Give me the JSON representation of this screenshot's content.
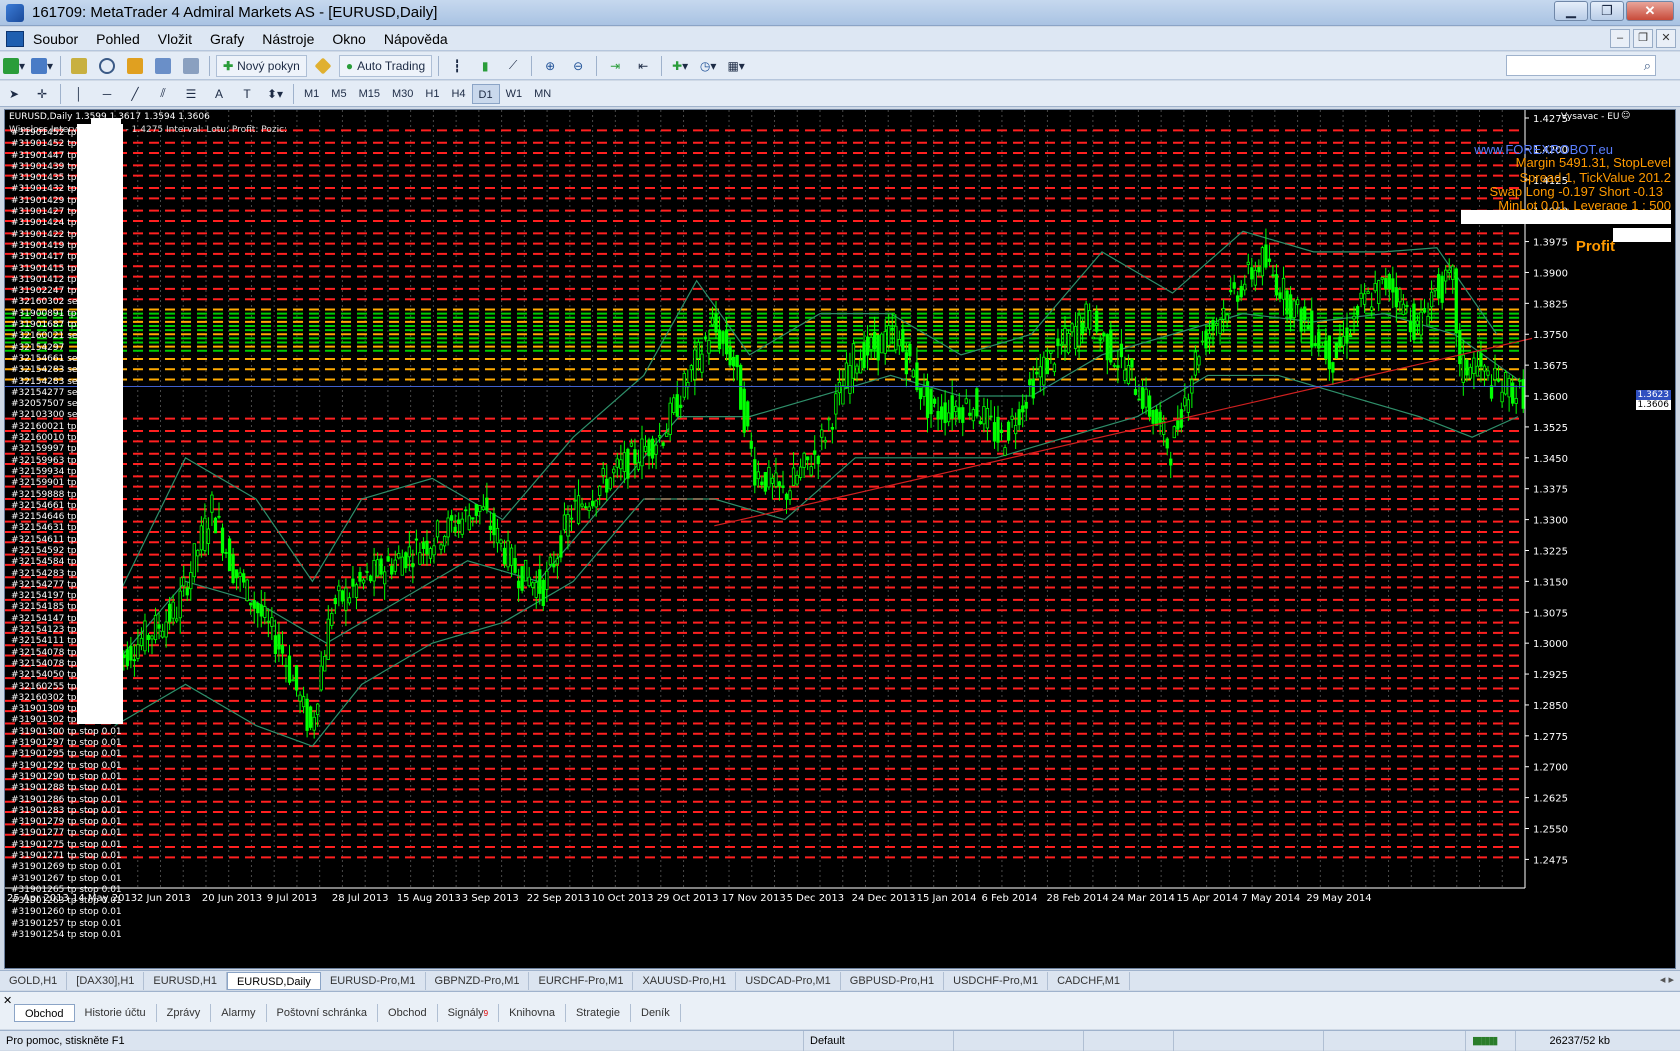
{
  "window": {
    "title": "161709: MetaTrader 4 Admiral Markets AS - [EURUSD,Daily]",
    "minimize": "▁",
    "maximize": "❐",
    "close": "✕"
  },
  "menu": [
    "Soubor",
    "Pohled",
    "Vložit",
    "Grafy",
    "Nástroje",
    "Okno",
    "Nápověda"
  ],
  "mdi_buttons": [
    "–",
    "❐",
    "✕"
  ],
  "toolbar": {
    "new_order": "Nový pokyn",
    "auto_trading": "Auto Trading"
  },
  "timeframes": [
    "M1",
    "M5",
    "M15",
    "M30",
    "H1",
    "H4",
    "D1",
    "W1",
    "MN"
  ],
  "active_timeframe": "D1",
  "chart": {
    "header": "EURUSD,Daily  1.3599 1.3617 1.3594 1.3606",
    "subheader": "Winsloss  Interval: 1.2425 - 1.4275   Interval:    Lotu:    Profit:    Pozic:",
    "expert_label": "Vysavac - EU",
    "info_lines": [
      "www.FOREXROBOT.eu",
      "Margin 5491.31, StopLevel",
      "Spread 1, TickValue 201.2",
      "Swap Long -0.197 Short -0.13",
      "MinLot 0.01, Leverage 1 : 500"
    ],
    "profit_label": "Profit",
    "current_price": "1.3606",
    "ask_price": "1.3623",
    "colors": {
      "background": "#000000",
      "candle": "#00ff00",
      "red_level": "#ff2020",
      "green_level": "#00cc00",
      "orange_level": "#ffaa00",
      "bands": "#2e8f6a",
      "trendline": "#d02020",
      "price_line": "#4060d0",
      "info_text": "#ff9a00"
    }
  },
  "orders": [
    "#31901452 tp",
    "#31901452 tp",
    "#31901447 tp",
    "#31901439 tp",
    "#31901435 tp",
    "#31901432 tp",
    "#31901429 tp",
    "#31901427 tp",
    "#31901424 tp",
    "#31901422 tp",
    "#31901419 tp",
    "#31901417 tp",
    "#31901415 tp",
    "#31901412 tp",
    "#31902247 tp",
    "#32160302 sel",
    "#31900891 tp",
    "#31901687 tp",
    "#32160021 se",
    "#32154297",
    "#32154661 se",
    "#32154283 se",
    "#32154283 sel",
    "#32154277 sel",
    "#32057507 sel",
    "#32103300 sel",
    "#32160021 tp",
    "#32160010 tp",
    "#32159997 tp",
    "#32159963 tp",
    "#32159934 tp",
    "#32159901 tp",
    "#32159888 tp",
    "#32154661 tp",
    "#32154646 tp",
    "#32154631 tp",
    "#32154611 tp",
    "#32154592 tp",
    "#32154584 tp",
    "#32154283 tp",
    "#32154277 tp",
    "#32154197 tp",
    "#32154185 tp",
    "#32154147 tp",
    "#32154123 tp",
    "#32154111 tp",
    "#32154078 tp",
    "#32154078 tp stop 0.01",
    "#32154050 tp stop 0.01",
    "#32160255 tp stop 0.01",
    "#32160302 tp stop 0.01",
    "#31901309 tp stop 0.01",
    "#31901302 tp stop 0.01",
    "#31901300 tp stop 0.01",
    "#31901297 tp stop 0.01",
    "#31901295 tp stop 0.01",
    "#31901292 tp stop 0.01",
    "#31901290 tp stop 0.01",
    "#31901288 tp stop 0.01",
    "#31901286 tp stop 0.01",
    "#31901283 tp stop 0.01",
    "#31901279 tp stop 0.01",
    "#31901277 tp stop 0.01",
    "#31901275 tp stop 0.01",
    "#31901271 tp stop 0.01",
    "#31901269 tp stop 0.01",
    "#31901267 tp stop 0.01",
    "#31901265 tp stop 0.01",
    "#31901263 tp stop 0.01",
    "#31901260 tp stop 0.01",
    "#31901257 tp stop 0.01",
    "#31901254 tp stop 0.01"
  ],
  "chart_data": {
    "type": "candlestick",
    "symbol": "EURUSD",
    "timeframe": "Daily",
    "ylim": [
      1.2425,
      1.4275
    ],
    "yticks": [
      "1.4275",
      "1.4200",
      "1.4125",
      "1.4050",
      "1.3975",
      "1.3900",
      "1.3825",
      "1.3750",
      "1.3675",
      "1.3600",
      "1.3525",
      "1.3450",
      "1.3375",
      "1.3300",
      "1.3225",
      "1.3150",
      "1.3075",
      "1.3000",
      "1.2925",
      "1.2850",
      "1.2775",
      "1.2700",
      "1.2625",
      "1.2550",
      "1.2475"
    ],
    "xticks": [
      "25 Apr 2013",
      "14 May 2013",
      "2 Jun 2013",
      "20 Jun 2013",
      "9 Jul 2013",
      "28 Jul 2013",
      "15 Aug 2013",
      "3 Sep 2013",
      "22 Sep 2013",
      "10 Oct 2013",
      "29 Oct 2013",
      "17 Nov 2013",
      "5 Dec 2013",
      "24 Dec 2013",
      "15 Jan 2014",
      "6 Feb 2014",
      "28 Feb 2014",
      "24 Mar 2014",
      "15 Apr 2014",
      "7 May 2014",
      "29 May 2014"
    ],
    "last": {
      "open": 1.3599,
      "high": 1.3617,
      "low": 1.3594,
      "close": 1.3606
    },
    "path_points": [
      [
        0,
        1.295
      ],
      [
        18,
        1.308
      ],
      [
        28,
        1.333
      ],
      [
        34,
        1.318
      ],
      [
        48,
        1.298
      ],
      [
        56,
        1.279
      ],
      [
        62,
        1.309
      ],
      [
        76,
        1.318
      ],
      [
        90,
        1.325
      ],
      [
        104,
        1.333
      ],
      [
        114,
        1.318
      ],
      [
        122,
        1.313
      ],
      [
        130,
        1.332
      ],
      [
        146,
        1.344
      ],
      [
        156,
        1.351
      ],
      [
        170,
        1.377
      ],
      [
        176,
        1.368
      ],
      [
        182,
        1.342
      ],
      [
        190,
        1.336
      ],
      [
        200,
        1.347
      ],
      [
        210,
        1.369
      ],
      [
        222,
        1.375
      ],
      [
        232,
        1.356
      ],
      [
        244,
        1.358
      ],
      [
        252,
        1.349
      ],
      [
        262,
        1.365
      ],
      [
        276,
        1.379
      ],
      [
        290,
        1.363
      ],
      [
        300,
        1.347
      ],
      [
        308,
        1.372
      ],
      [
        318,
        1.385
      ],
      [
        326,
        1.393
      ],
      [
        336,
        1.38
      ],
      [
        346,
        1.369
      ],
      [
        354,
        1.382
      ],
      [
        362,
        1.388
      ],
      [
        370,
        1.376
      ],
      [
        374,
        1.385
      ],
      [
        380,
        1.388
      ],
      [
        382,
        1.366
      ],
      [
        386,
        1.368
      ],
      [
        391,
        1.363
      ],
      [
        396,
        1.362
      ],
      [
        399,
        1.3606
      ]
    ],
    "bands": {
      "upper": [
        [
          0,
          1.31
        ],
        [
          20,
          1.345
        ],
        [
          40,
          1.335
        ],
        [
          56,
          1.315
        ],
        [
          70,
          1.335
        ],
        [
          90,
          1.34
        ],
        [
          110,
          1.33
        ],
        [
          130,
          1.35
        ],
        [
          150,
          1.365
        ],
        [
          165,
          1.388
        ],
        [
          180,
          1.37
        ],
        [
          200,
          1.38
        ],
        [
          220,
          1.38
        ],
        [
          240,
          1.37
        ],
        [
          260,
          1.375
        ],
        [
          280,
          1.395
        ],
        [
          300,
          1.385
        ],
        [
          320,
          1.4
        ],
        [
          340,
          1.395
        ],
        [
          360,
          1.395
        ],
        [
          375,
          1.396
        ],
        [
          392,
          1.375
        ]
      ],
      "middle": [
        [
          0,
          1.295
        ],
        [
          20,
          1.315
        ],
        [
          40,
          1.31
        ],
        [
          60,
          1.3
        ],
        [
          80,
          1.31
        ],
        [
          100,
          1.32
        ],
        [
          120,
          1.315
        ],
        [
          140,
          1.335
        ],
        [
          160,
          1.355
        ],
        [
          180,
          1.355
        ],
        [
          200,
          1.36
        ],
        [
          220,
          1.365
        ],
        [
          240,
          1.36
        ],
        [
          260,
          1.36
        ],
        [
          280,
          1.37
        ],
        [
          300,
          1.375
        ],
        [
          320,
          1.38
        ],
        [
          340,
          1.378
        ],
        [
          360,
          1.38
        ],
        [
          380,
          1.375
        ],
        [
          398,
          1.364
        ]
      ],
      "lower": [
        [
          0,
          1.28
        ],
        [
          20,
          1.29
        ],
        [
          40,
          1.28
        ],
        [
          56,
          1.275
        ],
        [
          70,
          1.29
        ],
        [
          90,
          1.3
        ],
        [
          110,
          1.305
        ],
        [
          130,
          1.315
        ],
        [
          150,
          1.335
        ],
        [
          170,
          1.335
        ],
        [
          190,
          1.33
        ],
        [
          210,
          1.345
        ],
        [
          230,
          1.345
        ],
        [
          250,
          1.345
        ],
        [
          270,
          1.35
        ],
        [
          290,
          1.355
        ],
        [
          310,
          1.365
        ],
        [
          330,
          1.365
        ],
        [
          350,
          1.36
        ],
        [
          370,
          1.355
        ],
        [
          385,
          1.35
        ],
        [
          398,
          1.355
        ]
      ]
    },
    "trendline": [
      [
        170,
        1.3285
      ],
      [
        402,
        1.374
      ]
    ],
    "red_levels": [
      1.4245,
      1.4215,
      1.419,
      1.416,
      1.4135,
      1.4105,
      1.408,
      1.405,
      1.4025,
      1.3995,
      1.397,
      1.3945,
      1.3915,
      1.389,
      1.386,
      1.3835,
      1.3545,
      1.3515,
      1.349,
      1.346,
      1.3435,
      1.3405,
      1.338,
      1.335,
      1.3325,
      1.3295,
      1.327,
      1.3245,
      1.3215,
      1.319,
      1.316,
      1.3135,
      1.3105,
      1.308,
      1.305,
      1.3025,
      1.2995,
      1.297,
      1.2945,
      1.2915,
      1.289,
      1.286,
      1.2835,
      1.2805,
      1.278,
      1.275,
      1.2725,
      1.2695,
      1.267,
      1.2645,
      1.2615,
      1.259,
      1.256,
      1.2535,
      1.2505,
      1.248
    ],
    "green_levels": [
      1.38,
      1.379,
      1.377,
      1.376,
      1.374,
      1.373,
      1.371
    ],
    "orange_levels": [
      1.381,
      1.378,
      1.375,
      1.372,
      1.369,
      1.3665,
      1.364
    ],
    "price_line": 1.3623
  },
  "symbol_tabs": [
    "GOLD,H1",
    "[DAX30],H1",
    "EURUSD,H1",
    "EURUSD,Daily",
    "EURUSD-Pro,M1",
    "GBPNZD-Pro,M1",
    "EURCHF-Pro,M1",
    "XAUUSD-Pro,H1",
    "USDCAD-Pro,M1",
    "GBPUSD-Pro,H1",
    "USDCHF-Pro,M1",
    "CADCHF,M1"
  ],
  "active_symbol_tab": "EURUSD,Daily",
  "terminal_tabs": [
    "Obchod",
    "Historie účtu",
    "Zprávy",
    "Alarmy",
    "Poštovní schránka",
    "Obchod",
    "Signály",
    "Knihovna",
    "Strategie",
    "Deník"
  ],
  "terminal_signals_badge": "9",
  "status": {
    "help": "Pro pomoc, stiskněte F1",
    "profile": "Default",
    "traffic": "26237/52 kb"
  }
}
